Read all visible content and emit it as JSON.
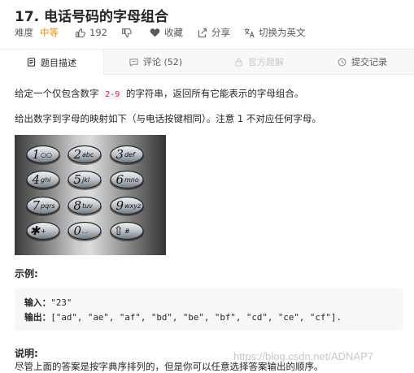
{
  "problem": {
    "title": "17. 电话号码的字母组合",
    "difficulty_label": "难度",
    "difficulty": "中等",
    "likes": "192",
    "favorite": "收藏",
    "share": "分享",
    "switch_lang": "切换为英文"
  },
  "tabs": [
    {
      "label": "题目描述",
      "icon": "doc-icon",
      "active": true
    },
    {
      "label": "评论 (52)",
      "icon": "comment-icon",
      "active": false
    },
    {
      "label": "官方题解",
      "icon": "lock-icon",
      "active": false,
      "disabled": true
    },
    {
      "label": "提交记录",
      "icon": "clock-icon",
      "active": false
    }
  ],
  "description": {
    "p1_before": "给定一个仅包含数字 ",
    "p1_code": "2-9",
    "p1_after": " 的字符串，返回所有它能表示的字母组合。",
    "p2": "给出数字到字母的映射如下（与电话按键相同）。注意 1 不对应任何字母。"
  },
  "keypad": {
    "keys": [
      {
        "digit": "1",
        "letters": "○○"
      },
      {
        "digit": "2",
        "letters": "abc"
      },
      {
        "digit": "3",
        "letters": "def"
      },
      {
        "digit": "4",
        "letters": "ghi"
      },
      {
        "digit": "5",
        "letters": "jkl"
      },
      {
        "digit": "6",
        "letters": "mno"
      },
      {
        "digit": "7",
        "letters": "pqrs"
      },
      {
        "digit": "8",
        "letters": "tuv"
      },
      {
        "digit": "9",
        "letters": "wxyz"
      },
      {
        "digit": "✱",
        "letters": "+"
      },
      {
        "digit": "0",
        "letters": "⌴"
      },
      {
        "digit": "⇧",
        "letters": "#"
      }
    ]
  },
  "example": {
    "label": "示例:",
    "input_label": "输入：",
    "input_value": "\"23\"",
    "output_label": "输出：",
    "output_value": "[\"ad\", \"ae\", \"af\", \"bd\", \"be\", \"bf\", \"cd\", \"ce\", \"cf\"]."
  },
  "note": {
    "label": "说明:",
    "text": "尽管上面的答案是按字典序排列的，但是你可以任意选择答案输出的顺序。"
  },
  "watermark": "https://blog.csdn.net/ADNAP7",
  "colors": {
    "difficulty_medium": "#ef8e12",
    "code_inline": "#c7254e"
  }
}
